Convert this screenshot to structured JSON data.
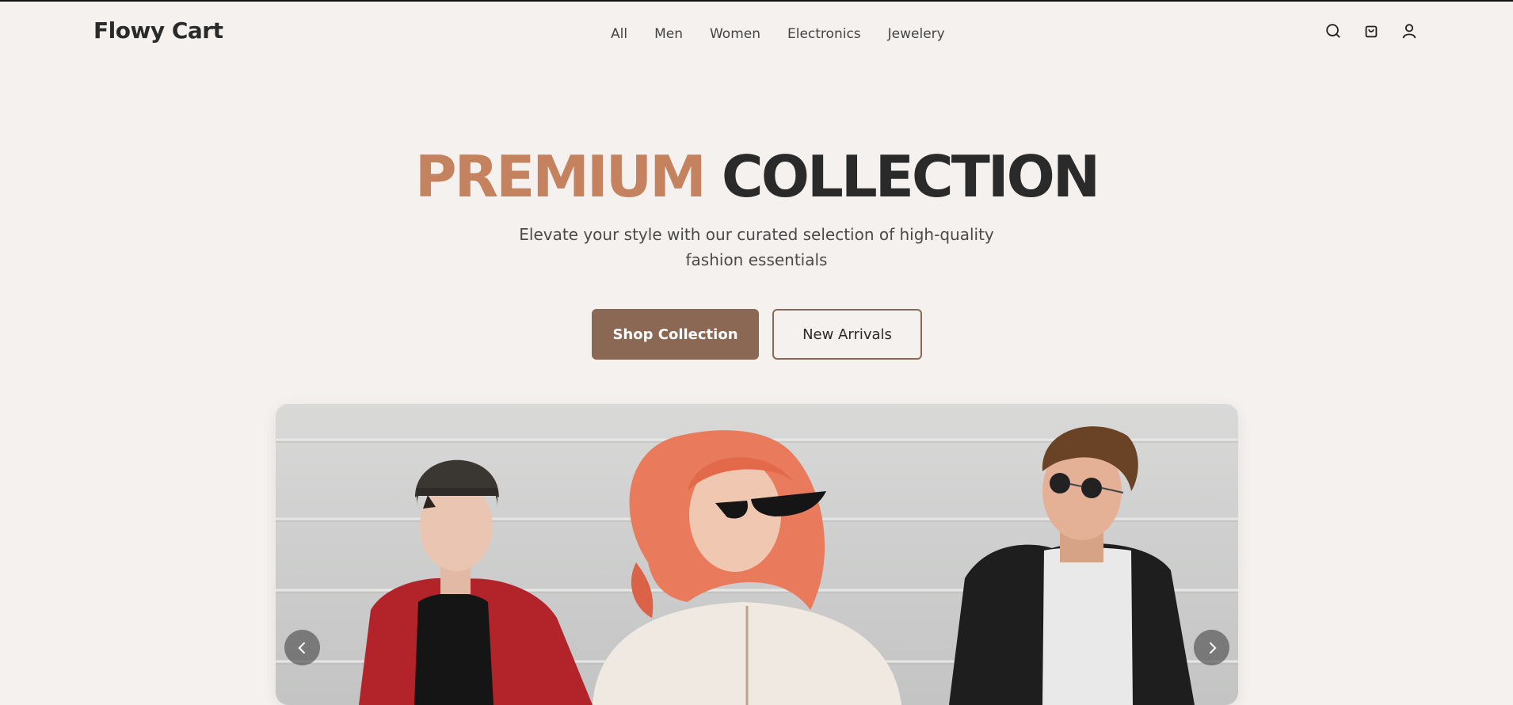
{
  "header": {
    "logo": "Flowy Cart",
    "nav": [
      "All",
      "Men",
      "Women",
      "Electronics",
      "Jewelery"
    ],
    "icons": [
      "search-icon",
      "cart-icon",
      "user-icon"
    ]
  },
  "hero": {
    "title_accent": "PREMIUM",
    "title_rest": "COLLECTION",
    "subtitle": "Elevate your style with our curated selection of high-quality fashion essentials",
    "primary_button": "Shop Collection",
    "secondary_button": "New Arrivals"
  },
  "carousel": {
    "prev_icon": "chevron-left-icon",
    "next_icon": "chevron-right-icon"
  },
  "colors": {
    "background": "#f5f1ef",
    "accent": "#c4825f",
    "brand_brown": "#8b6853",
    "text_dark": "#2a2a2a"
  }
}
